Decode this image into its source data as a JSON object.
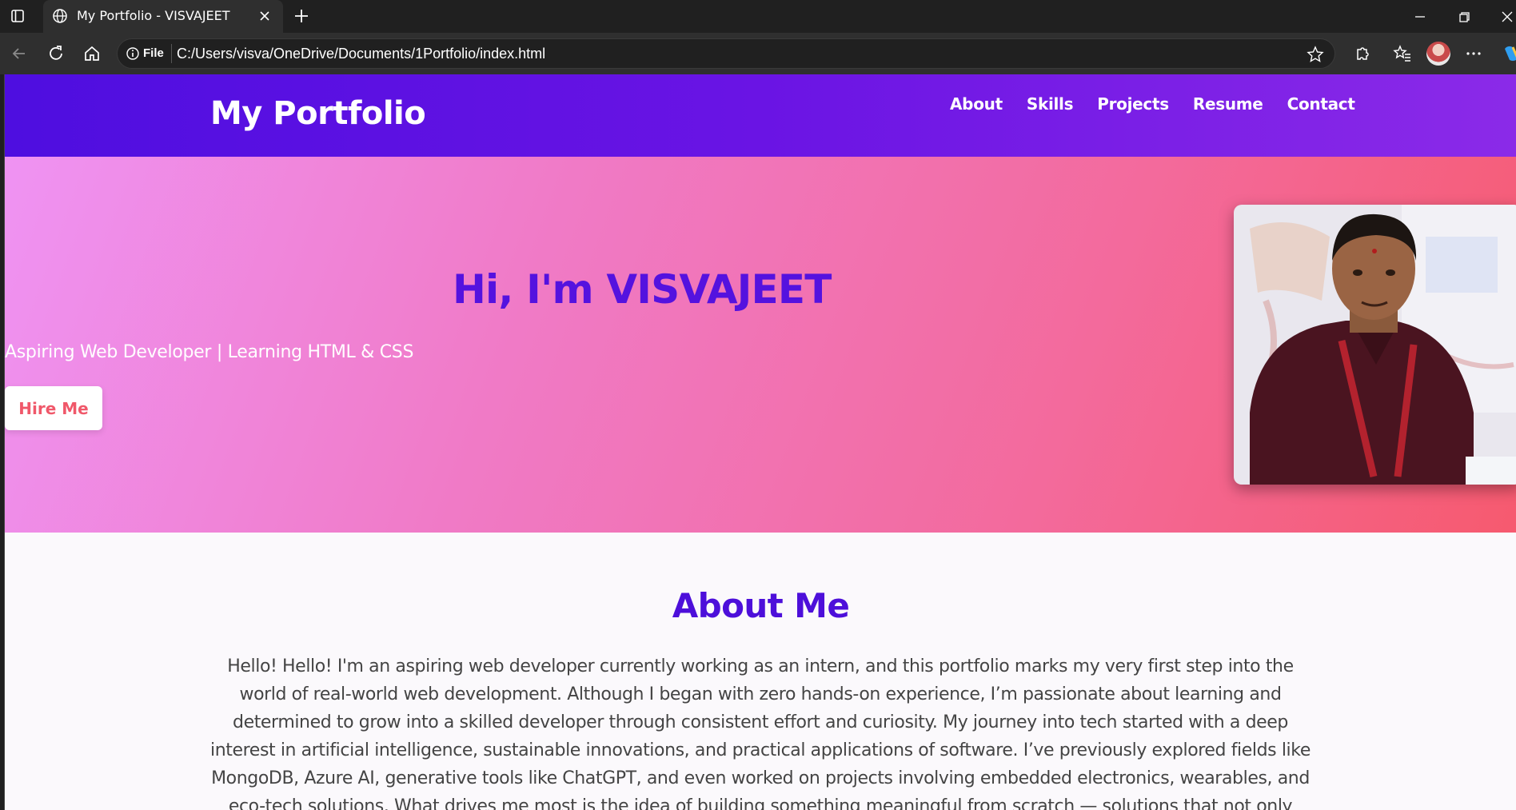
{
  "browser": {
    "tab_title": "My Portfolio - VISVAJEET",
    "address_scheme_label": "File",
    "address_url": "C:/Users/visva/OneDrive/Documents/1Portfolio/index.html"
  },
  "site": {
    "logo": "My Portfolio",
    "nav": [
      "About",
      "Skills",
      "Projects",
      "Resume",
      "Contact"
    ]
  },
  "hero": {
    "title": "Hi, I'm VISVAJEET",
    "subtitle": "Aspiring Web Developer | Learning HTML & CSS",
    "cta": "Hire Me"
  },
  "about": {
    "title": "About Me",
    "text": "Hello! Hello! I'm an aspiring web developer currently working as an intern, and this portfolio marks my very first step into the world of real-world web development. Although I began with zero hands-on experience, I’m passionate about learning and determined to grow into a skilled developer through consistent effort and curiosity. My journey into tech started with a deep interest in artificial intelligence, sustainable innovations, and practical applications of software. I’ve previously explored fields like MongoDB, Azure AI, generative tools like ChatGPT, and even worked on projects involving embedded electronics, wearables, and eco-tech solutions. What drives me most is the idea of building something meaningful from scratch — solutions that not only solve problems but also create impact. This portfolio reflects not just my"
  },
  "colors": {
    "header_start": "#4e0ee0",
    "header_end": "#8b2ae8",
    "hero_start": "#ef93f3",
    "hero_end": "#f65a6f",
    "accent_purple": "#5412df",
    "cta_text": "#f0586a"
  }
}
